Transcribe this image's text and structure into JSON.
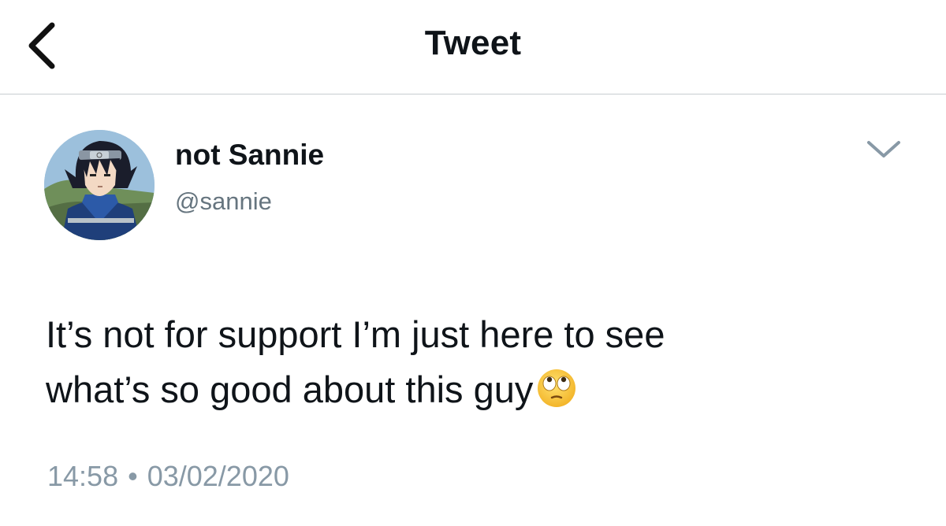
{
  "header": {
    "title": "Tweet"
  },
  "tweet": {
    "author": {
      "display_name": "not Sannie",
      "handle": "@sannie"
    },
    "text_lines": [
      "It’s not for support I’m just here to see",
      "what’s so good about this guy"
    ],
    "emoji": "face-with-rolling-eyes",
    "time": "14:58",
    "separator": "•",
    "date": "03/02/2020"
  },
  "icons": {
    "back": "chevron-left-icon",
    "more": "chevron-down-icon"
  },
  "colors": {
    "text": "#0f1419",
    "secondary": "#66757f",
    "meta": "#8899a6",
    "divider": "#c8cdd1"
  }
}
